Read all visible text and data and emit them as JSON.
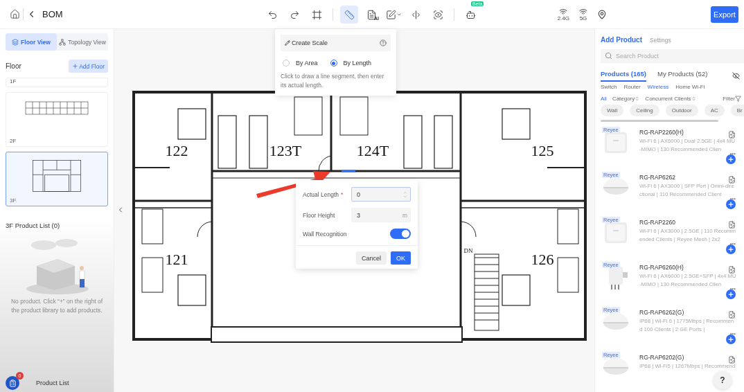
{
  "header": {
    "title": "BOM",
    "export": "Export"
  },
  "toolbar": [
    {
      "kind": "undo",
      "selected": false
    },
    {
      "kind": "redo",
      "selected": false
    },
    {
      "kind": "frame",
      "selected": false
    },
    {
      "kind": "ruler",
      "selected": true
    },
    {
      "kind": "ai-text",
      "label": "AI",
      "selected": false
    },
    {
      "kind": "edit-menu",
      "selected": false
    },
    {
      "kind": "split",
      "selected": false
    },
    {
      "kind": "view",
      "selected": false
    },
    {
      "kind": "assistant",
      "badge": "Beta",
      "selected": false
    }
  ],
  "signals": [
    {
      "kind": "wifi",
      "label": "2.4G"
    },
    {
      "kind": "wifi",
      "label": "5G"
    },
    {
      "kind": "pin"
    }
  ],
  "left": {
    "view_tabs": [
      {
        "label": "Floor View",
        "kind": "floor",
        "selected": true
      },
      {
        "label": "Topology View",
        "kind": "topology",
        "selected": false
      }
    ],
    "floor_title": "Floor",
    "add_floor": "Add Floor",
    "floors": [
      {
        "label": "1F",
        "kind": "partial",
        "selected": false
      },
      {
        "label": "2F",
        "kind": "wide",
        "selected": false
      },
      {
        "label": "3F",
        "kind": "plan",
        "selected": true
      }
    ],
    "product_list_title": "3F Product List (0)",
    "empty_text": "No product. Click “+” on the right of the product library to add products.",
    "footer": {
      "label": "Product List",
      "badge": "0"
    }
  },
  "floor_plan": {
    "rooms": [
      {
        "label": "122"
      },
      {
        "label": "123T"
      },
      {
        "label": "124T"
      },
      {
        "label": "125"
      },
      {
        "label": "121"
      },
      {
        "label": "126"
      },
      {
        "label": "DN"
      }
    ]
  },
  "create_scale": {
    "title": "Create Scale",
    "options": [
      {
        "label": "By Area",
        "selected": false
      },
      {
        "label": "By Length",
        "selected": true
      }
    ],
    "hint": "Click to draw a line segment, then enter its actual length."
  },
  "scale_dialog": {
    "fields": [
      {
        "label": "Actual Length",
        "mark": "*",
        "value": "0",
        "kind": "stepper"
      },
      {
        "label": "Floor Height",
        "value": "3",
        "unit": "m",
        "kind": "unit"
      }
    ],
    "wall_recognition": {
      "label": "Wall Recognition",
      "on": true
    },
    "buttons": [
      {
        "label": "Cancel",
        "kind": "secondary"
      },
      {
        "label": "OK",
        "kind": "primary"
      }
    ]
  },
  "right": {
    "tabs": [
      {
        "label": "Add Product",
        "selected": true
      },
      {
        "label": "Settings",
        "selected": false
      }
    ],
    "search": {
      "placeholder": "Search Product"
    },
    "library_tabs": [
      {
        "label": "Products (165)",
        "selected": true
      },
      {
        "label": "My Products (52)",
        "selected": false
      }
    ],
    "categories": [
      {
        "label": "Switch",
        "selected": false
      },
      {
        "label": "Router",
        "selected": false
      },
      {
        "label": "Wireless",
        "selected": true
      },
      {
        "label": "Home Wi-Fi",
        "selected": false
      }
    ],
    "all": "All",
    "sorts": [
      "Category",
      "Concurrent Clients"
    ],
    "filter": "Filter",
    "chips": [
      "Wall",
      "Ceiling",
      "Outdoor",
      "AC",
      "Br"
    ],
    "products": [
      {
        "brand": "Reyee",
        "name": "RG-RAP2260(H)",
        "desc": [
          "Wi-Fi 6 | AX6000 | Dual 2.5GE | 4x4 MU",
          "-MIMO | 130 Recommended Clien"
        ],
        "more": "...",
        "kind": "square"
      },
      {
        "brand": "Reyee",
        "name": "RG-RAP6262",
        "desc": [
          "Wi-Fi 6 | AX3000 | SFP Port | Omni-dire",
          "ctional | 110 Recommended Client"
        ],
        "more": "...",
        "kind": "dome"
      },
      {
        "brand": "Reyee",
        "name": "RG-RAP2260",
        "desc": [
          "Wi-Fi 6 | AX3000 | 2.5GE | 110 Recomm",
          "ended Clients | Reyee Mesh | 2x2"
        ],
        "more": "...",
        "kind": "square"
      },
      {
        "brand": "Reyee",
        "name": "RG-RAP6260(H)",
        "desc": [
          "Wi-Fi 6 | AX6000 | 2.5GE+SFP | 4x4 MU",
          "-MIMO | 130 Recommended Clien"
        ],
        "more": "...",
        "kind": "outdoor"
      },
      {
        "brand": "Reyee",
        "name": "RG-RAP6262(G)",
        "desc": [
          "IP68 | Wi-Fi 6 | 1775Mbps | Recommen",
          "d 100 Clients | 2 GE Ports |"
        ],
        "more": "...",
        "kind": "dome"
      },
      {
        "brand": "Reyee",
        "name": "RG-RAP6202(G)",
        "desc": [
          "IP68 | Wi-Fi5 | 1267Mbps | Recommend"
        ],
        "kind": "dome"
      }
    ],
    "help": "?"
  }
}
